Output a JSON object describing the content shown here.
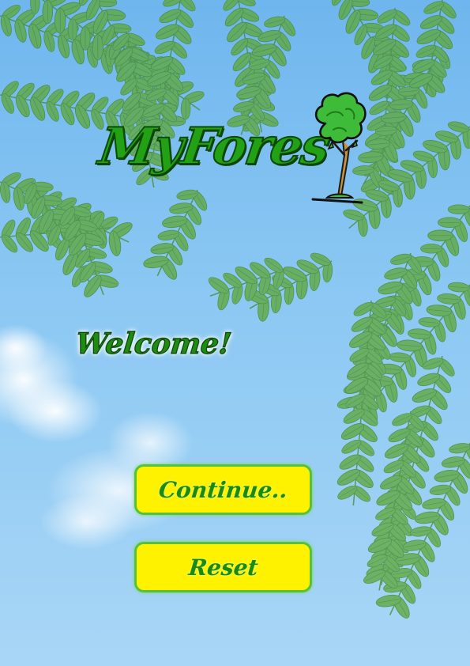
{
  "app": {
    "title": "MyFores"
  },
  "logo": {
    "icon": "tree-icon"
  },
  "greeting": {
    "text": "Welcome!"
  },
  "buttons": {
    "continue_label": "Continue..",
    "reset_label": "Reset"
  },
  "colors": {
    "sky": "#8cc8f3",
    "leaf": "#5aa53a",
    "title": "#22a114",
    "button_fill": "#fff200",
    "button_border": "#55c23a",
    "button_text": "#1a8a12"
  }
}
